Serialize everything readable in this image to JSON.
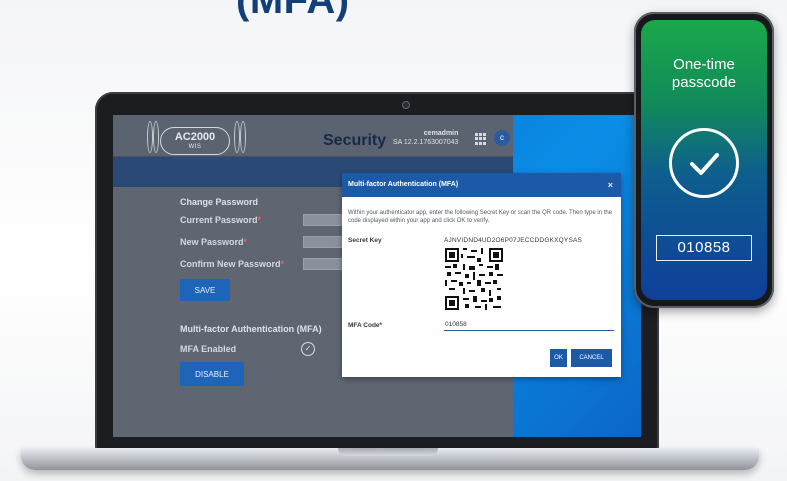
{
  "headline": "(MFA)",
  "app": {
    "logo_title": "AC2000",
    "logo_subtitle": "WIS",
    "page_title": "Security",
    "user_name": "cemadmin",
    "version": "SA 12.2.1763007043",
    "avatar_initial": "c"
  },
  "change_password": {
    "section_title": "Change Password",
    "current_label": "Current Password",
    "new_label": "New Password",
    "confirm_label": "Confirm New Password",
    "required_mark": "*",
    "save_button": "SAVE"
  },
  "mfa_section": {
    "section_title": "Multi-factor Authentication (MFA)",
    "enabled_label": "MFA Enabled",
    "disable_button": "DISABLE"
  },
  "modal": {
    "title": "Multi-factor Authentication (MFA)",
    "close": "×",
    "description": "Within your authenticator app, enter the following Secret Key or scan the QR code. Then type in the code displayed within your app and click OK to verify.",
    "secret_key_label": "Secret Key",
    "secret_key_value": "AJNVIDND4UD2O6P07JECCDDGKXQYSAS",
    "mfa_code_label": "MFA Code",
    "required_mark": "*",
    "mfa_code_value": "010858",
    "ok_button": "OK",
    "cancel_button": "CANCEL"
  },
  "phone": {
    "title_line1": "One-time",
    "title_line2": "passcode",
    "passcode": "010858"
  },
  "colors": {
    "accent": "#1c5aa8",
    "screen_blue": "#0a8de6",
    "phone_green": "#1aa84a"
  }
}
